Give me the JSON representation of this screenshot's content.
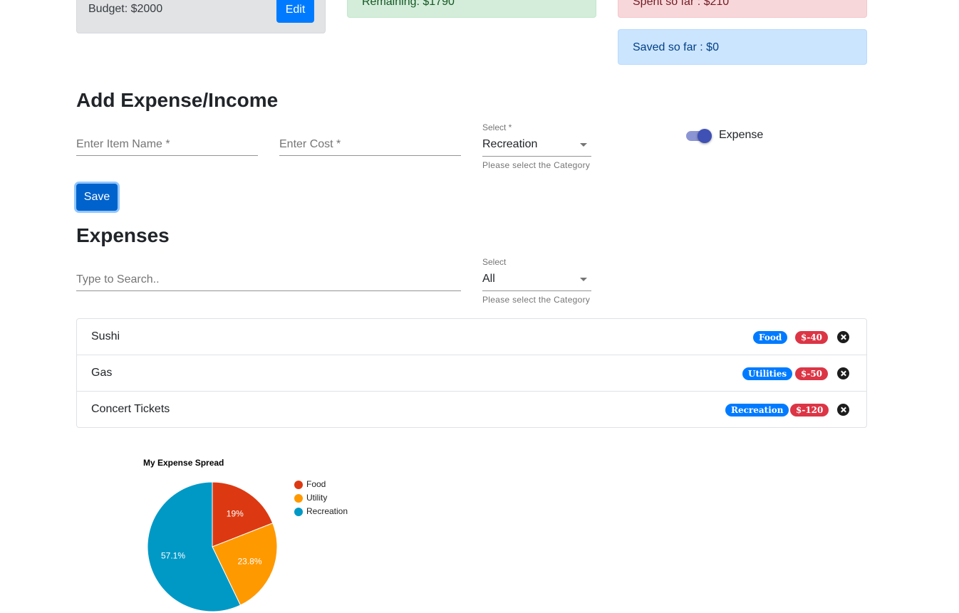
{
  "summary": {
    "budget_text": "Budget: $2000",
    "edit_label": "Edit",
    "remaining_text": "Remaining: $1790",
    "spent_text": "Spent so far : $210",
    "saved_text": "Saved so far : $0"
  },
  "add_form": {
    "heading": "Add Expense/Income",
    "item_placeholder": "Enter Item Name *",
    "cost_placeholder": "Enter Cost *",
    "select_label": "Select *",
    "select_value": "Recreation",
    "select_helper": "Please select the Category",
    "toggle_label": "Expense",
    "toggle_on": true,
    "save_label": "Save"
  },
  "expenses": {
    "heading": "Expenses",
    "search_placeholder": "Type to Search..",
    "filter_label": "Select",
    "filter_value": "All",
    "filter_helper": "Please select the Category",
    "items": [
      {
        "name": "Sushi",
        "category": "Food",
        "amount": "$-40"
      },
      {
        "name": "Gas",
        "category": "Utilities",
        "amount": "$-50"
      },
      {
        "name": "Concert Tickets",
        "category": "Recreation",
        "amount": "$-120"
      }
    ]
  },
  "colors": {
    "primary": "#007bff",
    "danger": "#dc3545",
    "food": "#dc3912",
    "utility": "#ff9900",
    "recreation": "#0099c6"
  },
  "chart_data": {
    "type": "pie",
    "title": "My Expense Spread",
    "legend_position": "right",
    "categories": [
      "Food",
      "Utility",
      "Recreation"
    ],
    "values": [
      40,
      50,
      120
    ],
    "labels": [
      "19%",
      "23.8%",
      "57.1%"
    ]
  }
}
